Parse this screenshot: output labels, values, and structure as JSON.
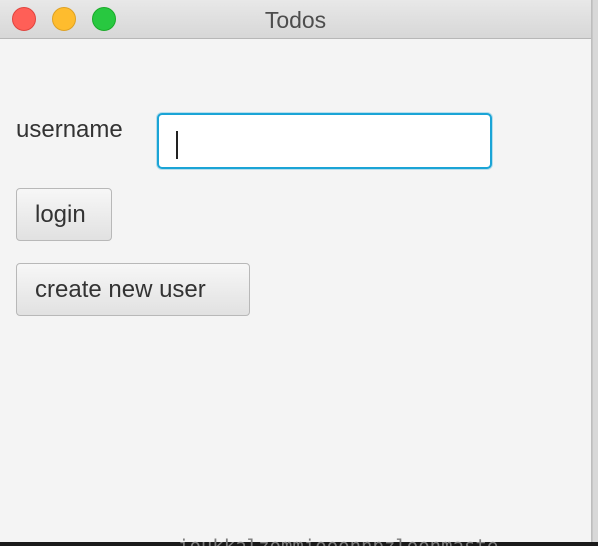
{
  "window": {
    "title": "Todos"
  },
  "login_form": {
    "username_label": "username",
    "username_value": "",
    "login_button": "login",
    "create_user_button": "create new user"
  },
  "background": {
    "clipped_text": "ioukkalzommiooonnpzloonmaste"
  },
  "colors": {
    "focus_ring": "#1aa4d6",
    "close": "#ff5f57",
    "minimize": "#febc2e",
    "zoom": "#28c840"
  }
}
